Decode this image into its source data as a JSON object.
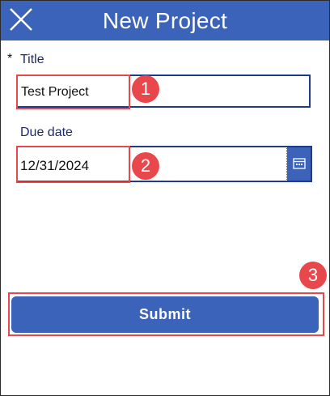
{
  "header": {
    "title": "New Project",
    "close_icon": "close-icon"
  },
  "form": {
    "required_marker": "*",
    "title_label": "Title",
    "title_value": "Test Project",
    "due_date_label": "Due date",
    "due_date_value": "12/31/2024",
    "calendar_icon": "calendar-icon"
  },
  "submit_label": "Submit",
  "annotations": {
    "step1": "1",
    "step2": "2",
    "step3": "3"
  },
  "colors": {
    "header_bg": "#3b63b9",
    "label_text": "#1d2a6b",
    "input_border": "#1f3a8a",
    "highlight": "#e8474b"
  }
}
